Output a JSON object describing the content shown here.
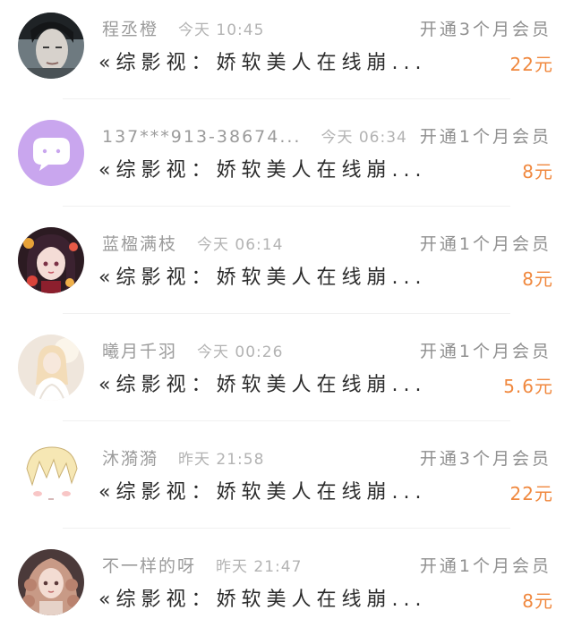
{
  "orders": [
    {
      "name": "程丞橙",
      "time": "今天 10:45",
      "title": "«综影视：娇软美人在线崩...",
      "desc": "开通3个月会员",
      "amount": "22元",
      "avatar_icon": "male-portrait-avatar-icon"
    },
    {
      "name": "137***913-38674...",
      "time": "今天 06:34",
      "title": "«综影视：娇软美人在线崩...",
      "desc": "开通1个月会员",
      "amount": "8元",
      "avatar_icon": "chat-bubble-avatar-icon"
    },
    {
      "name": "蓝楹满枝",
      "time": "今天 06:14",
      "title": "«综影视：娇软美人在线崩...",
      "desc": "开通1个月会员",
      "amount": "8元",
      "avatar_icon": "anime-girl-flowers-avatar-icon"
    },
    {
      "name": "曦月千羽",
      "time": "今天 00:26",
      "title": "«综影视：娇软美人在线崩...",
      "desc": "开通1个月会员",
      "amount": "5.6元",
      "avatar_icon": "white-dress-girl-avatar-icon"
    },
    {
      "name": "沐漪漪",
      "time": "昨天 21:58",
      "title": "«综影视：娇软美人在线崩...",
      "desc": "开通3个月会员",
      "amount": "22元",
      "avatar_icon": "cartoon-blonde-avatar-icon"
    },
    {
      "name": "不一样的呀",
      "time": "昨天 21:47",
      "title": "«综影视：娇软美人在线崩...",
      "desc": "开通1个月会员",
      "amount": "8元",
      "avatar_icon": "curly-hair-girl-avatar-icon"
    }
  ],
  "colors": {
    "amount": "#f0883e",
    "name": "#9b9b9b",
    "title": "#2b2b2b",
    "chat_avatar_bg": "#c9a6ee"
  }
}
